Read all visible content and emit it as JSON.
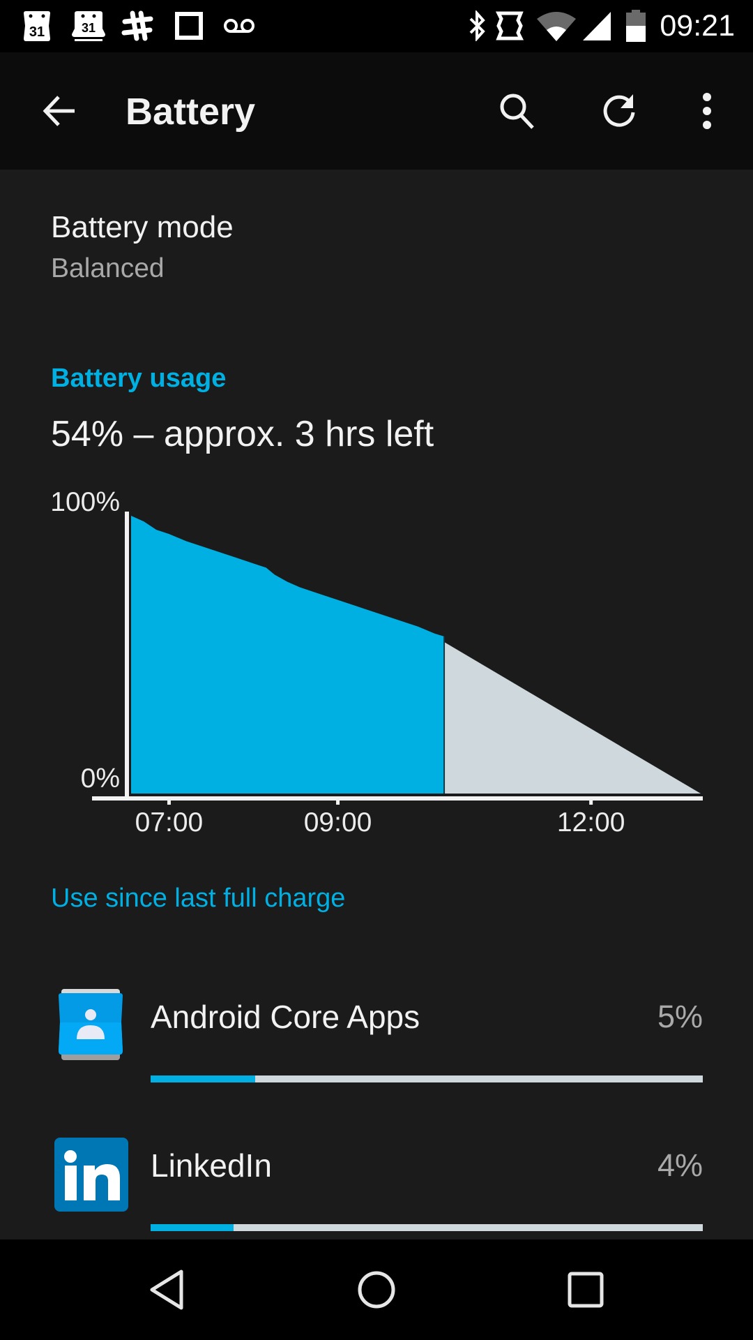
{
  "status_bar": {
    "time": "09:21",
    "left_icons": [
      "calendar-icon",
      "calendar-icon",
      "slack-icon",
      "square-icon",
      "voicemail-icon"
    ],
    "right_icons": [
      "bluetooth-icon",
      "nfc-icon",
      "wifi-icon",
      "cell-signal-icon",
      "battery-icon"
    ],
    "battery_level_percent": 54
  },
  "app_bar": {
    "title": "Battery",
    "back_icon": "arrow-back-icon",
    "actions": [
      "search-icon",
      "refresh-icon",
      "more-vert-icon"
    ]
  },
  "battery_mode": {
    "title": "Battery mode",
    "summary": "Balanced"
  },
  "battery_usage": {
    "header": "Battery usage",
    "status": "54% – approx. 3 hrs left"
  },
  "chart_data": {
    "type": "area",
    "title": "",
    "xlabel": "",
    "ylabel": "",
    "ylim": [
      0,
      100
    ],
    "y_tick_labels": [
      "100%",
      "0%"
    ],
    "x_tick_labels": [
      "07:00",
      "09:00",
      "12:00"
    ],
    "x_ticks_hours": [
      7,
      9,
      12
    ],
    "xlim_hours": [
      6.55,
      13.3
    ],
    "grid": false,
    "legend": "none",
    "colors": {
      "actual": "#00b0e3",
      "projected": "#cfd8dc",
      "axis": "#f2f2f2"
    },
    "series": [
      {
        "name": "actual",
        "points": [
          [
            6.55,
            99
          ],
          [
            6.7,
            97
          ],
          [
            6.85,
            94
          ],
          [
            7.0,
            92.5
          ],
          [
            7.2,
            90
          ],
          [
            7.4,
            88
          ],
          [
            7.6,
            86
          ],
          [
            7.8,
            84
          ],
          [
            8.0,
            82
          ],
          [
            8.15,
            80.5
          ],
          [
            8.25,
            78
          ],
          [
            8.4,
            75.5
          ],
          [
            8.55,
            73.5
          ],
          [
            8.8,
            71
          ],
          [
            9.05,
            68.5
          ],
          [
            9.3,
            66
          ],
          [
            9.55,
            63.5
          ],
          [
            9.75,
            61.5
          ],
          [
            9.95,
            59.5
          ],
          [
            10.15,
            57
          ],
          [
            10.26,
            56
          ]
        ]
      },
      {
        "name": "projected",
        "points": [
          [
            10.26,
            54
          ],
          [
            13.3,
            0
          ]
        ]
      }
    ],
    "current_time_marker_hours": 10.26
  },
  "use_since_charge": {
    "header": "Use since last full charge",
    "apps": [
      {
        "name": "Android Core Apps",
        "percent_label": "5%",
        "bar_fraction": 0.19,
        "icon": "contacts-app-icon"
      },
      {
        "name": "LinkedIn",
        "percent_label": "4%",
        "bar_fraction": 0.15,
        "icon": "linkedin-icon"
      }
    ]
  },
  "nav_bar": {
    "buttons": [
      "nav-back-icon",
      "nav-home-icon",
      "nav-recents-icon"
    ]
  }
}
